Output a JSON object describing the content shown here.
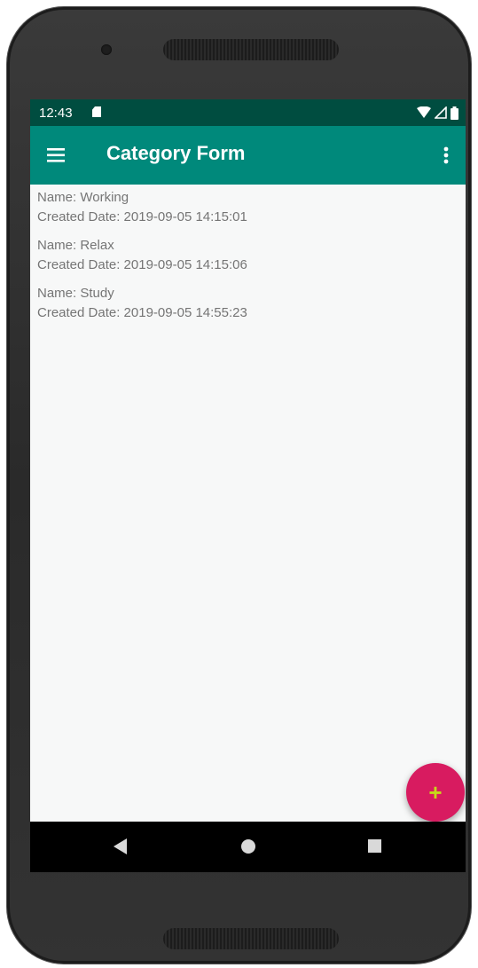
{
  "statusbar": {
    "time": "12:43",
    "icons": [
      "sd-card-icon",
      "wifi-icon",
      "signal-icon",
      "battery-icon"
    ]
  },
  "appbar": {
    "title": "Category Form",
    "menu_icon": "hamburger-menu-icon",
    "overflow_icon": "more-vert-icon"
  },
  "categories": [
    {
      "name": "Name: Working",
      "created": "Created Date: 2019-09-05 14:15:01"
    },
    {
      "name": "Name: Relax",
      "created": "Created Date: 2019-09-05 14:15:06"
    },
    {
      "name": "Name: Study",
      "created": "Created Date: 2019-09-05 14:55:23"
    }
  ],
  "fab": {
    "label": "+",
    "icon": "add-icon"
  },
  "navbar": {
    "icons": [
      "back-icon",
      "home-icon",
      "recents-icon"
    ]
  },
  "colors": {
    "statusbar": "#004d40",
    "appbar": "#00897b",
    "fab": "#d81b60",
    "fab_icon": "#c6d91a",
    "background": "#f7f8f8",
    "text": "#757575"
  }
}
